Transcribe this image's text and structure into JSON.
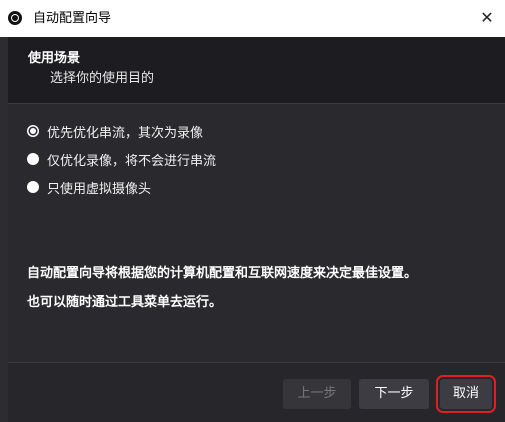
{
  "window": {
    "title": "自动配置向导",
    "app_icon": "obs-logo-icon",
    "close_icon": "close-icon",
    "close_glyph": "✕"
  },
  "header": {
    "title": "使用场景",
    "subtitle": "选择你的使用目的"
  },
  "options": [
    {
      "label": "优先优化串流，其次为录像",
      "checked": true
    },
    {
      "label": "仅优化录像，将不会进行串流",
      "checked": false
    },
    {
      "label": "只使用虚拟摄像头",
      "checked": false
    }
  ],
  "info": {
    "line1": "自动配置向导将根据您的计算机配置和互联网速度来决定最佳设置。",
    "line2": "也可以随时通过工具菜单去运行。"
  },
  "buttons": {
    "prev": "上一步",
    "next": "下一步",
    "cancel": "取消"
  },
  "colors": {
    "background": "#27272b",
    "header_bg": "#1d1d21",
    "highlight": "#e02020"
  }
}
